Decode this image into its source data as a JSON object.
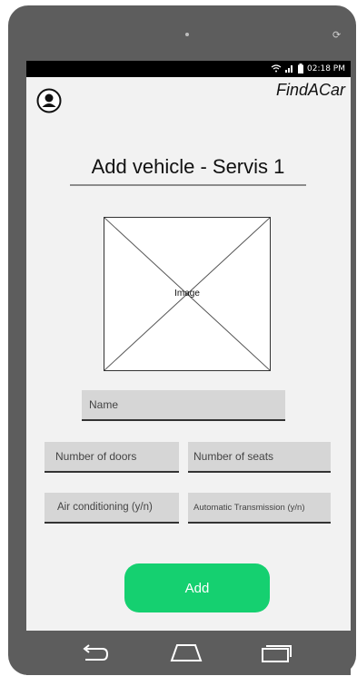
{
  "status_bar": {
    "time": "02:18 PM",
    "icons": [
      "wifi-icon",
      "signal-icon",
      "battery-icon"
    ]
  },
  "app": {
    "title": "FindACar"
  },
  "header": {
    "avatar_icon": "user-avatar-icon"
  },
  "form": {
    "title": "Add vehicle - Servis 1",
    "image_label": "Image",
    "fields": {
      "name": {
        "placeholder": "Name"
      },
      "doors": {
        "placeholder": "Number of doors"
      },
      "seats": {
        "placeholder": "Number of seats"
      },
      "ac": {
        "placeholder": "Air conditioning (y/n)"
      },
      "transmission": {
        "placeholder": "Automatic Transmission (y/n)"
      }
    },
    "submit_label": "Add"
  },
  "nav_bar": {
    "icons": [
      "back-icon",
      "home-icon",
      "recents-icon"
    ]
  },
  "colors": {
    "accent": "#15d070",
    "screen_bg": "#f2f2f2",
    "field_bg": "#d6d6d6",
    "device_frame": "#5d5d5d"
  }
}
